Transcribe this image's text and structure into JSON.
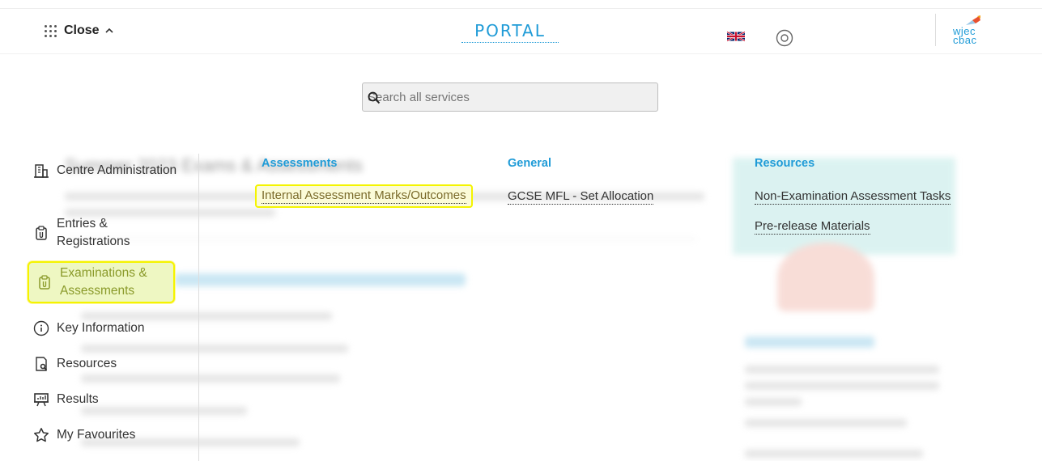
{
  "header": {
    "close_label": "Close",
    "title": "PORTAL",
    "logo_top": "wjec",
    "logo_bottom": "cbac"
  },
  "search": {
    "placeholder": "Search all services"
  },
  "background": {
    "heading": "Summer 2023 Exams & Assessments"
  },
  "sidebar": {
    "items": [
      {
        "label": "Centre Administration",
        "icon": "building-icon"
      },
      {
        "label": "Entries & Registrations",
        "icon": "clipboard-icon"
      },
      {
        "label": "Examinations & Assessments",
        "icon": "clipboard-icon",
        "active": true
      },
      {
        "label": "Key Information",
        "icon": "info-icon"
      },
      {
        "label": "Resources",
        "icon": "document-search-icon"
      },
      {
        "label": "Results",
        "icon": "presentation-icon"
      },
      {
        "label": "My Favourites",
        "icon": "star-icon"
      }
    ]
  },
  "columns": [
    {
      "heading": "Assessments",
      "links": [
        "Internal Assessment Marks/Outcomes"
      ]
    },
    {
      "heading": "General",
      "links": [
        "GCSE MFL - Set Allocation"
      ]
    },
    {
      "heading": "Resources",
      "links": [
        "Non-Examination Assessment Tasks",
        "Pre-release Materials"
      ]
    }
  ],
  "colors": {
    "accent": "#1f9bd7",
    "highlight": "#f4f400"
  }
}
